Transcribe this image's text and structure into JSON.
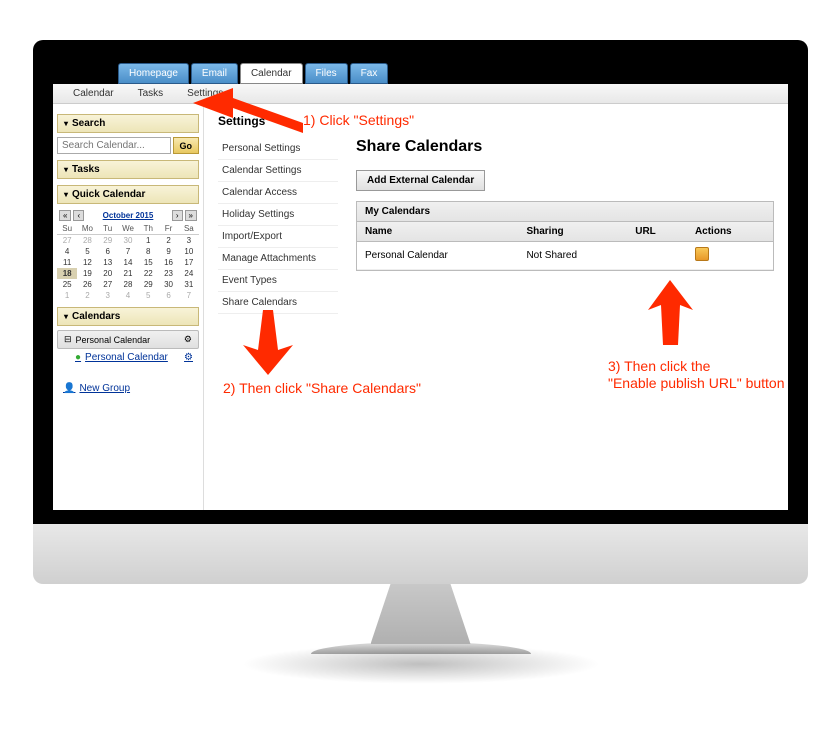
{
  "topnav": {
    "tabs": [
      "Homepage",
      "Email",
      "Calendar",
      "Files",
      "Fax"
    ],
    "active": 2
  },
  "subnav": [
    "Calendar",
    "Tasks",
    "Settings"
  ],
  "sidebar": {
    "search": {
      "title": "Search",
      "placeholder": "Search Calendar...",
      "go": "Go"
    },
    "tasks": {
      "title": "Tasks"
    },
    "quickcal": {
      "title": "Quick Calendar",
      "month": "October 2015",
      "dayheaders": [
        "Su",
        "Mo",
        "Tu",
        "We",
        "Th",
        "Fr",
        "Sa"
      ],
      "cells": [
        {
          "n": "27",
          "o": true
        },
        {
          "n": "28",
          "o": true
        },
        {
          "n": "29",
          "o": true
        },
        {
          "n": "30",
          "o": true
        },
        {
          "n": "1"
        },
        {
          "n": "2"
        },
        {
          "n": "3"
        },
        {
          "n": "4"
        },
        {
          "n": "5"
        },
        {
          "n": "6"
        },
        {
          "n": "7"
        },
        {
          "n": "8"
        },
        {
          "n": "9"
        },
        {
          "n": "10"
        },
        {
          "n": "11"
        },
        {
          "n": "12"
        },
        {
          "n": "13"
        },
        {
          "n": "14"
        },
        {
          "n": "15"
        },
        {
          "n": "16"
        },
        {
          "n": "17"
        },
        {
          "n": "18",
          "t": true
        },
        {
          "n": "19"
        },
        {
          "n": "20"
        },
        {
          "n": "21"
        },
        {
          "n": "22"
        },
        {
          "n": "23"
        },
        {
          "n": "24"
        },
        {
          "n": "25"
        },
        {
          "n": "26"
        },
        {
          "n": "27"
        },
        {
          "n": "28"
        },
        {
          "n": "29"
        },
        {
          "n": "30"
        },
        {
          "n": "31"
        },
        {
          "n": "1",
          "o": true
        },
        {
          "n": "2",
          "o": true
        },
        {
          "n": "3",
          "o": true
        },
        {
          "n": "4",
          "o": true
        },
        {
          "n": "5",
          "o": true
        },
        {
          "n": "6",
          "o": true
        },
        {
          "n": "7",
          "o": true
        }
      ]
    },
    "calendars": {
      "title": "Calendars",
      "folder": "Personal Calendar",
      "item": "Personal Calendar",
      "newgroup": "New Group"
    }
  },
  "main": {
    "settings_heading": "Settings",
    "menu": [
      "Personal Settings",
      "Calendar Settings",
      "Calendar Access",
      "Holiday Settings",
      "Import/Export",
      "Manage Attachments",
      "Event Types",
      "Share Calendars"
    ],
    "page_title": "Share Calendars",
    "add_button": "Add External Calendar",
    "table": {
      "caption": "My Calendars",
      "headers": [
        "Name",
        "Sharing",
        "URL",
        "Actions"
      ],
      "rows": [
        {
          "name": "Personal Calendar",
          "sharing": "Not Shared",
          "url": ""
        }
      ]
    }
  },
  "annotations": {
    "a1": "1) Click \"Settings\"",
    "a2": "2) Then click \"Share Calendars\"",
    "a3a": "3) Then click the",
    "a3b": "\"Enable publish URL\" button"
  }
}
